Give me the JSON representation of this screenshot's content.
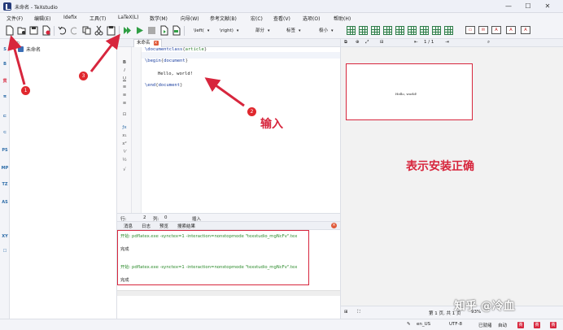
{
  "window": {
    "title": "未命名 - TeXstudio",
    "controls": [
      "—",
      "☐",
      "✕"
    ]
  },
  "menu": [
    "文件(F)",
    "编辑(E)",
    "Idefix",
    "工具(T)",
    "LaTeX(L)",
    "数学(M)",
    "向导(W)",
    "参考文献(B)",
    "宏(C)",
    "查看(V)",
    "选项(O)",
    "帮助(H)"
  ],
  "toolbar": {
    "combos": [
      "\\left(",
      "\\right)",
      "部分",
      "标签",
      "极小"
    ],
    "icons": [
      "new-file-icon",
      "open-file-icon",
      "save-icon",
      "close-file-icon",
      "undo-icon",
      "redo-icon",
      "copy-icon",
      "cut-icon",
      "paste-icon",
      "build-view-icon",
      "compile-icon",
      "stop-icon",
      "view-icon",
      "pdf-icon"
    ]
  },
  "leftbar": [
    "S",
    "B",
    "贯",
    "π",
    "⊏",
    "⊂",
    "PS",
    "MP",
    "TZ",
    "AS",
    "XY",
    "☐"
  ],
  "structure": {
    "header": "结构",
    "doc": "未命名"
  },
  "editor": {
    "tab": "未命名",
    "lines": [
      {
        "kw": "\\documentclass",
        "arg": "article"
      },
      {
        "kw": "\\begin",
        "arg": "document"
      },
      {
        "text": "Hello, world!"
      },
      {
        "kw": "\\end",
        "arg": "document"
      }
    ],
    "status": {
      "row_label": "行:",
      "row": "2",
      "col_label": "列:",
      "col": "0",
      "mode": "插入"
    }
  },
  "messages": {
    "tabs": [
      "消息",
      "日志",
      "预览",
      "搜索结果"
    ],
    "lines": [
      "开始: pdflatex.exe -synctex=1 -interaction=nonstopmode \"texstudio_mgNcFv\".tex",
      "完成",
      "开始: pdflatex.exe -synctex=1 -interaction=nonstopmode \"texstudio_mgNcFv\".tex",
      "完成"
    ]
  },
  "preview": {
    "page_label": "1 / 1",
    "page_text": "Hello, world!",
    "annotation": "表示安装正确",
    "status": {
      "page": "第 1 页, 共 1 页",
      "zoom": "93%"
    }
  },
  "bottom": {
    "lang": "en_US",
    "encoding": "UTF-8",
    "ready": "已就绪",
    "auto": "自动",
    "marks": [
      "赛",
      "赛",
      "赛"
    ]
  },
  "annotations": {
    "badges": [
      "1",
      "2",
      "3"
    ],
    "input_text": "输入"
  },
  "watermark": "知乎 @冷血",
  "colors": {
    "accent_red": "#d7263d",
    "compile_green": "#2f9e44",
    "keyword_blue": "#1b3fa0"
  }
}
